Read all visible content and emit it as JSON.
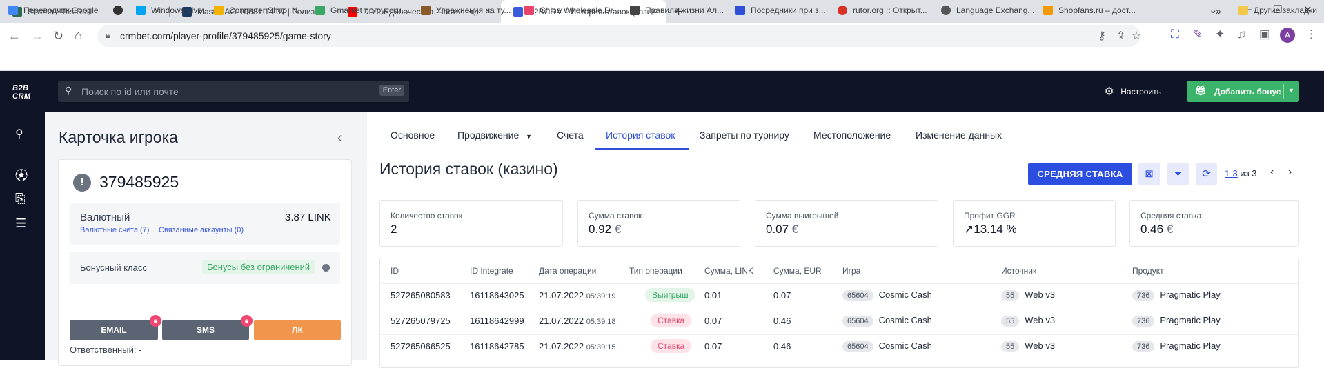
{
  "browser": {
    "tabs": [
      {
        "title": "Search - TestRail",
        "color": "#2d6a4f"
      },
      {
        "title": "Master AG-10681 14.07 | Релиз F",
        "color": "#1f3a5f"
      },
      {
        "title": "DDT. Единочество. Часть I (",
        "color": "#ff0000"
      },
      {
        "title": "B2BCRM - История ставок (кази",
        "color": "#3b5bdb"
      }
    ],
    "url": "crmbet.com/player-profile/379485925/game-story",
    "profile_initial": "A",
    "bookmarks": [
      {
        "label": "Переводчик Google",
        "color": "#4285f4"
      },
      {
        "label": "",
        "color": "#333333"
      },
      {
        "label": "Windows Live",
        "color": "#00a4ef"
      },
      {
        "label": "Computer Shop, N...",
        "color": "#f2b300"
      },
      {
        "label": "Gmarket по-русски...",
        "color": "#3aa865"
      },
      {
        "label": "Упражнения на ту...",
        "color": "#8b5a2b"
      },
      {
        "label": "China Wholesale,Dr...",
        "color": "#e8446a"
      },
      {
        "label": "Правила жизни Ал...",
        "color": "#444444"
      },
      {
        "label": "Посредники при з...",
        "color": "#2f4fd8"
      },
      {
        "label": "rutor.org :: Открыт...",
        "color": "#d93025"
      },
      {
        "label": "Language Exchang...",
        "color": "#555555"
      },
      {
        "label": "Shopfans.ru – дост...",
        "color": "#f29900"
      }
    ],
    "other_bookmarks": "Другие закладки"
  },
  "app": {
    "logo_line1": "B2B",
    "logo_line2": "CRM",
    "search_placeholder": "Поиск по id или почте",
    "search_hint": "Enter",
    "settings_label": "Настроить",
    "add_bonus_label": "Добавить бонус"
  },
  "player": {
    "panel_title": "Карточка игрока",
    "id": "379485925",
    "currency_type": "Валютный",
    "currency_accounts": "Валютные счета (7)",
    "linked_accounts": "Связанные аккаунты (0)",
    "balance": "3.87 LINK",
    "bonus_class_label": "Бонусный класс",
    "bonus_class_value": "Бонусы без ограничений",
    "btn_email": "EMAIL",
    "btn_sms": "SMS",
    "btn_lk": "ЛК",
    "responsible": "Ответственный: -"
  },
  "tabs": [
    {
      "label": "Основное"
    },
    {
      "label": "Продвижение"
    },
    {
      "label": "Счета"
    },
    {
      "label": "История ставок"
    },
    {
      "label": "Запреты по турниру"
    },
    {
      "label": "Местоположение"
    },
    {
      "label": "Изменение данных"
    }
  ],
  "history": {
    "title": "История ставок (казино)",
    "avg_button": "СРЕДНЯЯ СТАВКА",
    "pager_range": "1-3",
    "pager_total": "из 3"
  },
  "stats": [
    {
      "label": "Количество ставок",
      "value": "2",
      "currency": ""
    },
    {
      "label": "Сумма ставок",
      "value": "0.92",
      "currency": "€"
    },
    {
      "label": "Сумма выигрышей",
      "value": "0.07",
      "currency": "€"
    },
    {
      "label": "Профит GGR",
      "value": "↗13.14 %",
      "currency": ""
    },
    {
      "label": "Средняя ставка",
      "value": "0.46",
      "currency": "€"
    }
  ],
  "table": {
    "headers": [
      "ID",
      "ID Integrate",
      "Дата операции",
      "Тип операции",
      "Сумма, LINK",
      "Сумма, EUR",
      "Игра",
      "Источник",
      "Продукт"
    ],
    "rows": [
      {
        "id": "527265080583",
        "integrate": "16118643025",
        "date": "21.07.2022",
        "time": "05:39:19",
        "type": "Выигрыш",
        "kind": "win",
        "link": "0.01",
        "eur": "0.07",
        "game_id": "65604",
        "game": "Cosmic Cash",
        "src_id": "55",
        "source": "Web v3",
        "prod_id": "736",
        "product": "Pragmatic Play"
      },
      {
        "id": "527265079725",
        "integrate": "16118642999",
        "date": "21.07.2022",
        "time": "05:39:18",
        "type": "Ставка",
        "kind": "bet",
        "link": "0.07",
        "eur": "0.46",
        "game_id": "65604",
        "game": "Cosmic Cash",
        "src_id": "55",
        "source": "Web v3",
        "prod_id": "736",
        "product": "Pragmatic Play"
      },
      {
        "id": "527265066525",
        "integrate": "16118642785",
        "date": "21.07.2022",
        "time": "05:39:15",
        "type": "Ставка",
        "kind": "bet",
        "link": "0.07",
        "eur": "0.46",
        "game_id": "65604",
        "game": "Cosmic Cash",
        "src_id": "55",
        "source": "Web v3",
        "prod_id": "736",
        "product": "Pragmatic Play"
      }
    ]
  }
}
